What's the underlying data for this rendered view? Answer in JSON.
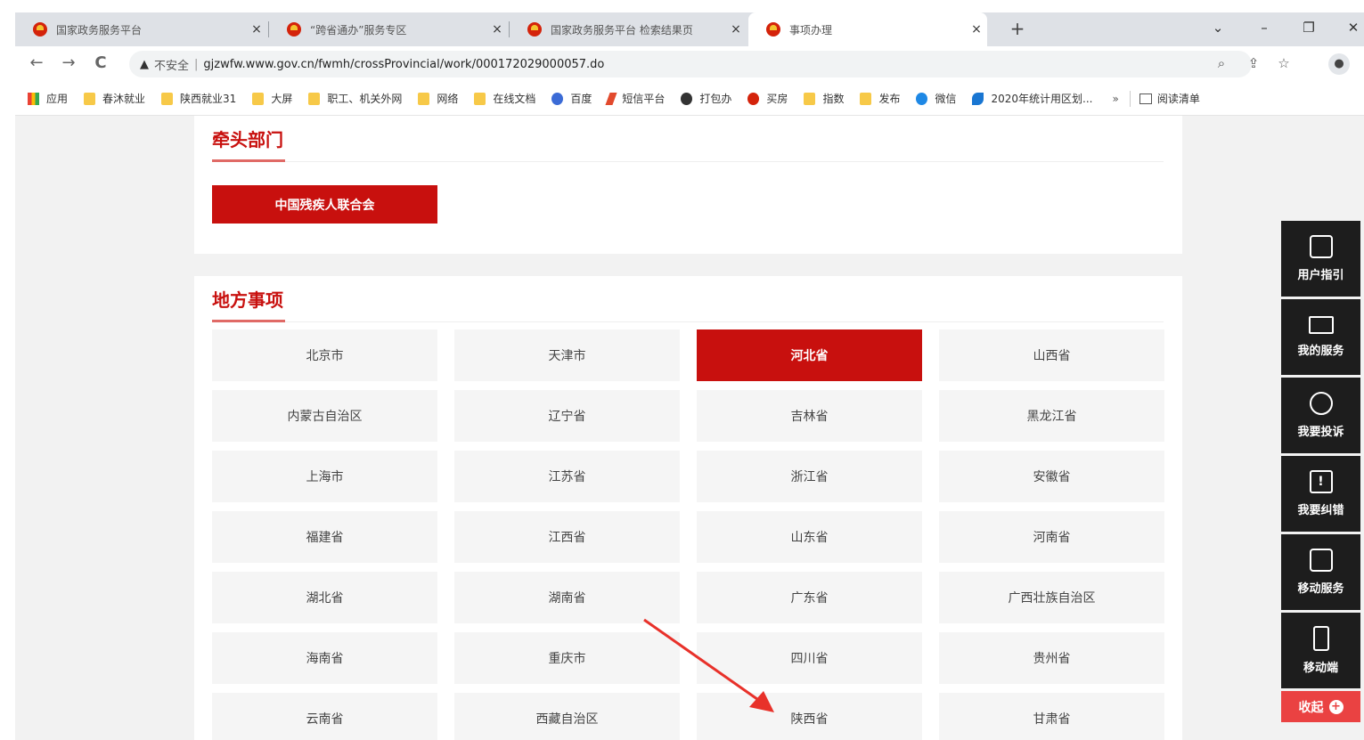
{
  "browser": {
    "tabs": [
      {
        "title": "国家政务服务平台",
        "close": "×",
        "active": false
      },
      {
        "title": "“跨省通办”服务专区",
        "close": "×",
        "active": false
      },
      {
        "title": "国家政务服务平台 检索结果页",
        "close": "×",
        "active": false
      },
      {
        "title": "事项办理",
        "close": "×",
        "active": true
      }
    ],
    "new_tab": "+",
    "window_controls": {
      "dropdown": "⌄",
      "minimize": "–",
      "restore": "❐",
      "close": "✕"
    },
    "nav": {
      "back": "←",
      "forward": "→",
      "reload": "C"
    },
    "address": {
      "security_icon": "▲",
      "security_text": "不安全",
      "divider": "|",
      "url": "gjzwfw.www.gov.cn/fwmh/crossProvincial/work/000172029000057.do"
    },
    "bookmarks": [
      {
        "label": "应用",
        "icon": "apps"
      },
      {
        "label": "春沐就业",
        "icon": "folder"
      },
      {
        "label": "陕西就业31",
        "icon": "folder"
      },
      {
        "label": "大屏",
        "icon": "folder"
      },
      {
        "label": "职工、机关外网",
        "icon": "folder"
      },
      {
        "label": "网络",
        "icon": "folder"
      },
      {
        "label": "在线文档",
        "icon": "folder"
      },
      {
        "label": "百度",
        "icon": "paw"
      },
      {
        "label": "短信平台",
        "icon": "feather"
      },
      {
        "label": "打包办",
        "icon": "globe"
      },
      {
        "label": "买房",
        "icon": "emblem"
      },
      {
        "label": "指数",
        "icon": "folder"
      },
      {
        "label": "发布",
        "icon": "folder"
      },
      {
        "label": "微信",
        "icon": "edge"
      },
      {
        "label": "2020年统计用区划...",
        "icon": "swirl"
      }
    ],
    "bookmarks_more": "»",
    "reading_list": "阅读清单"
  },
  "lead_dept": {
    "title": "牵头部门",
    "button": "中国残疾人联合会"
  },
  "local_items": {
    "title": "地方事项",
    "selected": "河北省",
    "regions": [
      "北京市",
      "天津市",
      "河北省",
      "山西省",
      "内蒙古自治区",
      "辽宁省",
      "吉林省",
      "黑龙江省",
      "上海市",
      "江苏省",
      "浙江省",
      "安徽省",
      "福建省",
      "江西省",
      "山东省",
      "河南省",
      "湖北省",
      "湖南省",
      "广东省",
      "广西壮族自治区",
      "海南省",
      "重庆市",
      "四川省",
      "贵州省",
      "云南省",
      "西藏自治区",
      "陕西省",
      "甘肃省"
    ]
  },
  "side_toolbar": {
    "items": [
      {
        "label": "用户指引",
        "icon": "guide-icon"
      },
      {
        "label": "我的服务",
        "icon": "monitor-icon"
      },
      {
        "label": "我要投诉",
        "icon": "complaint-icon"
      },
      {
        "label": "我要纠错",
        "icon": "error-report-icon"
      },
      {
        "label": "移动服务",
        "icon": "mobile-service-icon"
      },
      {
        "label": "移动端",
        "icon": "phone-icon"
      }
    ],
    "collapse": "收起",
    "collapse_icon": "+"
  },
  "colors": {
    "accent": "#c8100e",
    "toolbar_bg": "#1d1d1d",
    "collapse_bg": "#ea4242",
    "arrow": "#e8312a"
  }
}
